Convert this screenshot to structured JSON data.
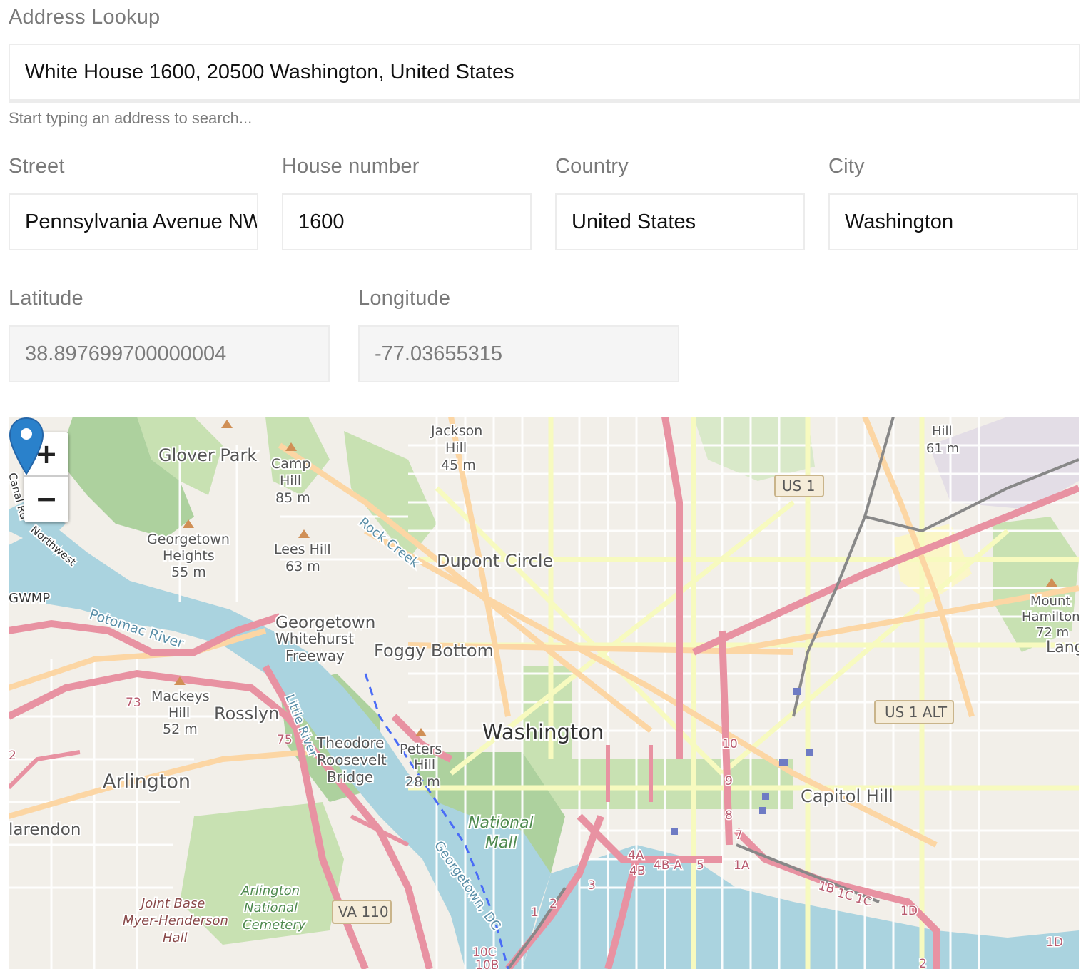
{
  "lookup": {
    "label": "Address Lookup",
    "value": "White House 1600, 20500 Washington, United States",
    "hint": "Start typing an address to search..."
  },
  "fields": {
    "street": {
      "label": "Street",
      "value": "Pennsylvania Avenue NW"
    },
    "house_number": {
      "label": "House number",
      "value": "1600"
    },
    "country": {
      "label": "Country",
      "value": "United States"
    },
    "city": {
      "label": "City",
      "value": "Washington"
    }
  },
  "coords": {
    "latitude": {
      "label": "Latitude",
      "value": "38.897699700000004"
    },
    "longitude": {
      "label": "Longitude",
      "value": "-77.03655315"
    }
  },
  "map": {
    "zoom_in": "+",
    "zoom_out": "−",
    "places": {
      "glover_park": "Glover Park",
      "camp_hill": "Camp",
      "camp_hill2": "Hill",
      "camp_hill3": "85 m",
      "jackson_hill": "Jackson",
      "jackson_hill2": "Hill",
      "jackson_hill3": "45 m",
      "georgetown_heights": "Georgetown",
      "georgetown_heights2": "Heights",
      "georgetown_heights3": "55 m",
      "lees_hill": "Lees Hill",
      "lees_hill2": "63 m",
      "rock_creek": "Rock Creek",
      "dupont_circle": "Dupont Circle",
      "gwmp": "GWMP",
      "potomac_river": "Potomac River",
      "georgetown": "Georgetown",
      "whitehurst": "Whitehurst",
      "freeway": "Freeway",
      "foggy_bottom": "Foggy Bottom",
      "mackeys": "Mackeys",
      "mackeys2": "Hill",
      "mackeys3": "52 m",
      "rosslyn": "Rosslyn",
      "little_river": "Little River",
      "theodore": "Theodore",
      "roosevelt": "Roosevelt",
      "bridge": "Bridge",
      "peters": "Peters",
      "peters2": "Hill",
      "peters3": "28 m",
      "washington": "Washington",
      "arlington": "Arlington",
      "clarendon": "larendon",
      "national": "National",
      "mall": "Mall",
      "capitol_hill": "Capitol Hill",
      "joint_base": "Joint Base",
      "myer": "Myer-Henderson",
      "hall": "Hall",
      "arl_nat": "Arlington",
      "arl_nat2": "National",
      "arl_nat3": "Cemetery",
      "georgetown_dc": "Georgetown, DC",
      "mount_hamilton": "Mount",
      "mount_hamilton2": "Hamilton",
      "mount_hamilton3": "72 m",
      "lang": "Lang",
      "hill_61": "Hill",
      "hill_61b": "61 m",
      "northwest": "Northwest",
      "canal_rd": "Canal Rd"
    },
    "shields": {
      "us1": "US 1",
      "us1alt": "US 1 ALT",
      "va110": "VA 110"
    },
    "exits": [
      "10",
      "9",
      "8",
      "7",
      "4A",
      "4B",
      "4B-A",
      "5",
      "1A",
      "1B",
      "1C",
      "1C",
      "1D",
      "3",
      "2",
      "1",
      "10C",
      "10B",
      "1D",
      "2",
      "73",
      "75",
      "2"
    ]
  }
}
